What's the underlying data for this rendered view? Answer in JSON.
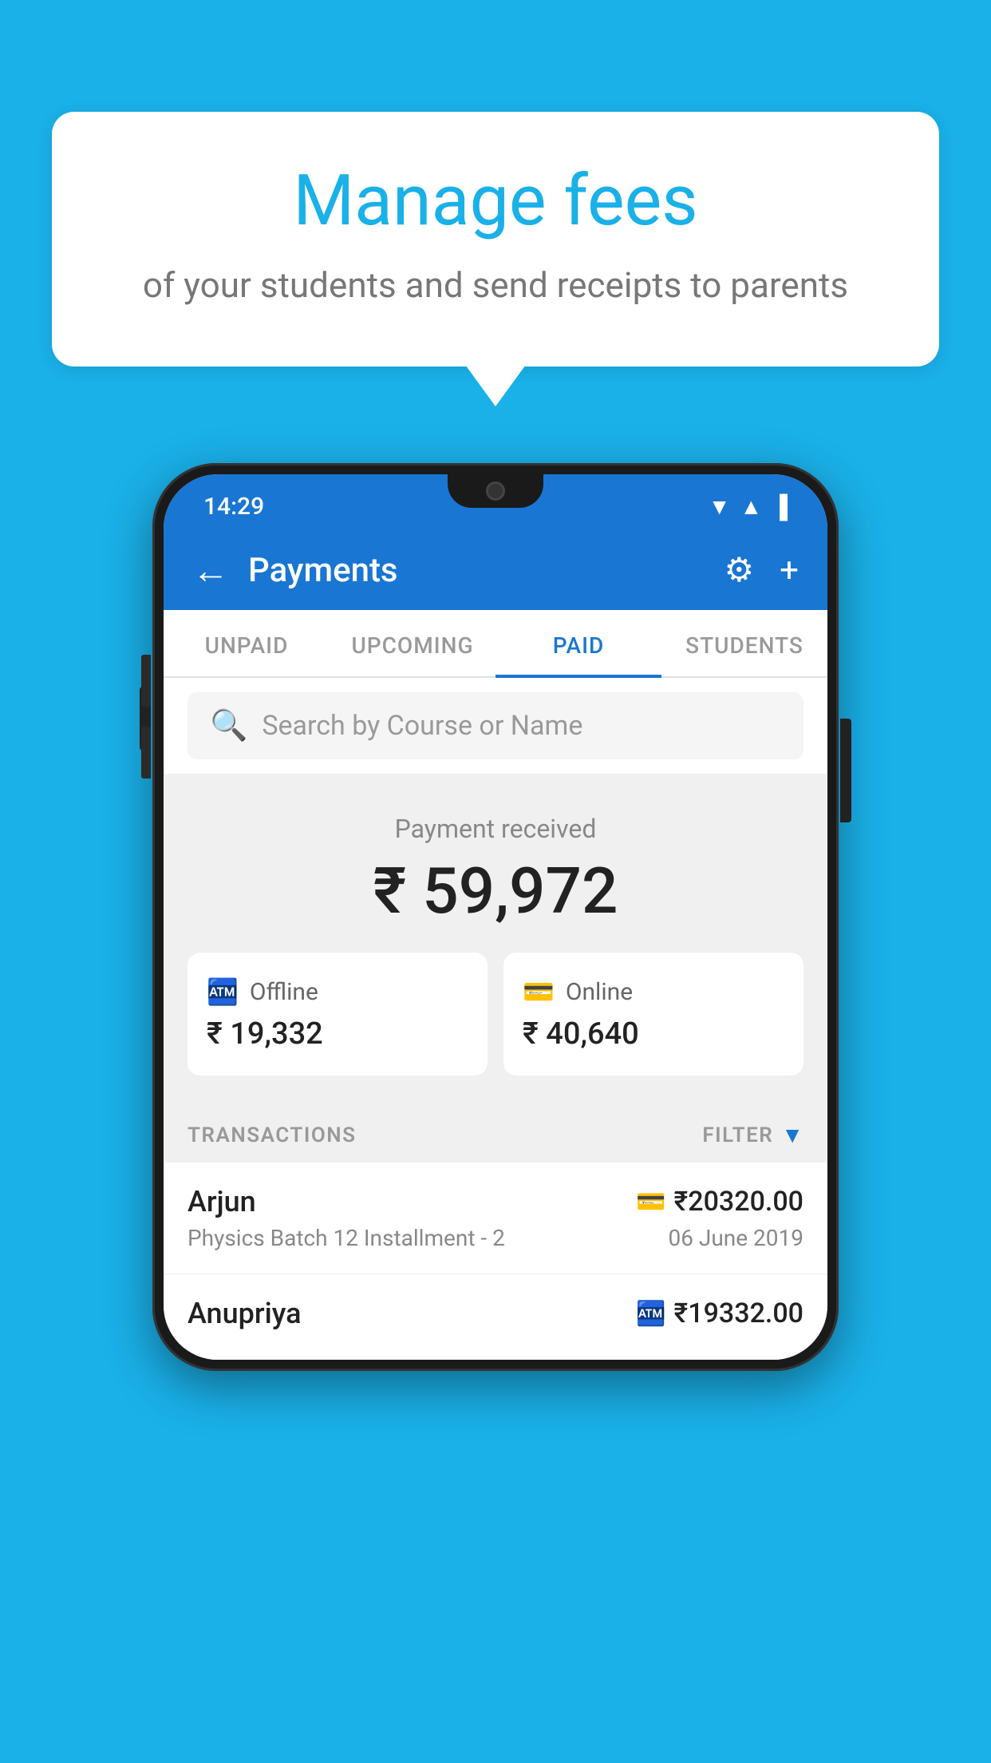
{
  "background_color": "#1ab0e8",
  "speech_bubble": {
    "heading": "Manage fees",
    "subtext": "of your students and send receipts to parents"
  },
  "status_bar": {
    "time": "14:29",
    "wifi": "▼",
    "signal": "▲",
    "battery": "▐"
  },
  "app_bar": {
    "title": "Payments",
    "back_label": "←",
    "settings_label": "⚙",
    "add_label": "+"
  },
  "tabs": [
    {
      "label": "UNPAID",
      "active": false
    },
    {
      "label": "UPCOMING",
      "active": false
    },
    {
      "label": "PAID",
      "active": true
    },
    {
      "label": "STUDENTS",
      "active": false
    }
  ],
  "search": {
    "placeholder": "Search by Course or Name"
  },
  "payment_summary": {
    "label": "Payment received",
    "total_amount": "₹ 59,972",
    "offline": {
      "label": "Offline",
      "amount": "₹ 19,332"
    },
    "online": {
      "label": "Online",
      "amount": "₹ 40,640"
    }
  },
  "transactions": {
    "header_label": "TRANSACTIONS",
    "filter_label": "FILTER",
    "items": [
      {
        "name": "Arjun",
        "course": "Physics Batch 12 Installment - 2",
        "amount": "₹20320.00",
        "date": "06 June 2019",
        "payment_type": "online"
      },
      {
        "name": "Anupriya",
        "course": "",
        "amount": "₹19332.00",
        "date": "",
        "payment_type": "offline"
      }
    ]
  }
}
